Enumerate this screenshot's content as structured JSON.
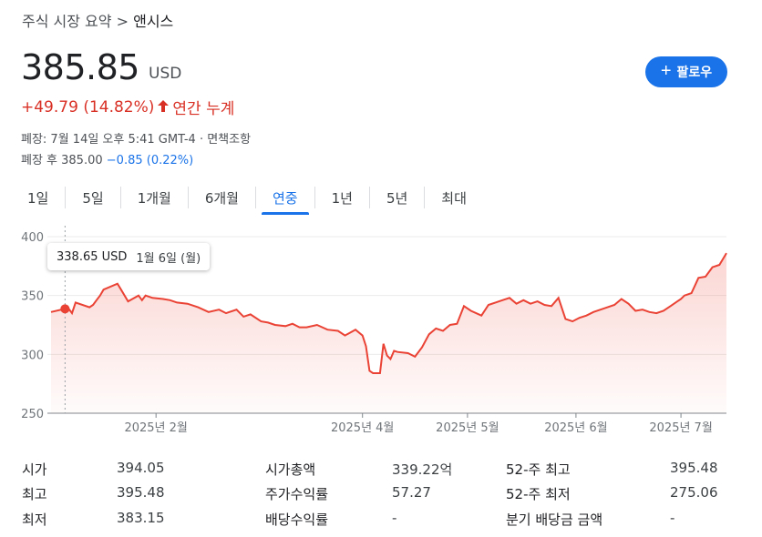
{
  "breadcrumb": {
    "parent": "주식 시장 요약",
    "sep": ">",
    "current": "앤시스"
  },
  "quote": {
    "price": "385.85",
    "currency": "USD",
    "change": "+49.79 (14.82%)",
    "period": "연간 누계",
    "closed_info": "폐장: 7월 14일 오후 5:41 GMT-4 · 면책조항",
    "after_label": "폐장 후 385.00",
    "after_change": "−0.85 (0.22%)"
  },
  "follow_button": {
    "label": "팔로우",
    "icon": "plus-icon"
  },
  "tabs": [
    {
      "label": "1일"
    },
    {
      "label": "5일"
    },
    {
      "label": "1개월"
    },
    {
      "label": "6개월"
    },
    {
      "label": "연중",
      "active": true
    },
    {
      "label": "1년"
    },
    {
      "label": "5년"
    },
    {
      "label": "최대"
    }
  ],
  "tooltip": {
    "value": "338.65 USD",
    "date": "1월 6일 (월)"
  },
  "colors": {
    "accent": "#1a73e8",
    "negative": "#d93025",
    "line": "#ea4335"
  },
  "chart_data": {
    "type": "area",
    "ylim": [
      250,
      400
    ],
    "yticks": [
      "400",
      "350",
      "300",
      "250"
    ],
    "xtick_labels": [
      "2025년 2월",
      "2025년 4월",
      "2025년 5월",
      "2025년 6월",
      "2025년 7월"
    ],
    "xtick_dates": [
      "2025-02-01",
      "2025-04-01",
      "2025-05-01",
      "2025-06-01",
      "2025-07-01"
    ],
    "range": [
      "2025-01-02",
      "2025-07-14"
    ],
    "series": [
      {
        "x": [
          "2025-01-02",
          "2025-01-06",
          "2025-01-07",
          "2025-01-08",
          "2025-01-09",
          "2025-01-13",
          "2025-01-14",
          "2025-01-15",
          "2025-01-16",
          "2025-01-17",
          "2025-01-21",
          "2025-01-22",
          "2025-01-24",
          "2025-01-27",
          "2025-01-28",
          "2025-01-29",
          "2025-01-31",
          "2025-02-03",
          "2025-02-05",
          "2025-02-07",
          "2025-02-10",
          "2025-02-13",
          "2025-02-16",
          "2025-02-19",
          "2025-02-21",
          "2025-02-24",
          "2025-02-26",
          "2025-02-28",
          "2025-03-03",
          "2025-03-05",
          "2025-03-07",
          "2025-03-10",
          "2025-03-12",
          "2025-03-14",
          "2025-03-16",
          "2025-03-19",
          "2025-03-22",
          "2025-03-25",
          "2025-03-27",
          "2025-03-30",
          "2025-04-01",
          "2025-04-02",
          "2025-04-03",
          "2025-04-04",
          "2025-04-06",
          "2025-04-07",
          "2025-04-08",
          "2025-04-09",
          "2025-04-10",
          "2025-04-11",
          "2025-04-14",
          "2025-04-16",
          "2025-04-18",
          "2025-04-20",
          "2025-04-22",
          "2025-04-24",
          "2025-04-26",
          "2025-04-28",
          "2025-04-30",
          "2025-05-02",
          "2025-05-05",
          "2025-05-07",
          "2025-05-09",
          "2025-05-11",
          "2025-05-13",
          "2025-05-15",
          "2025-05-17",
          "2025-05-19",
          "2025-05-21",
          "2025-05-23",
          "2025-05-25",
          "2025-05-27",
          "2025-05-29",
          "2025-05-31",
          "2025-06-02",
          "2025-06-04",
          "2025-06-06",
          "2025-06-08",
          "2025-06-10",
          "2025-06-12",
          "2025-06-14",
          "2025-06-16",
          "2025-06-18",
          "2025-06-20",
          "2025-06-22",
          "2025-06-24",
          "2025-06-26",
          "2025-06-28",
          "2025-06-30",
          "2025-07-01",
          "2025-07-02",
          "2025-07-04",
          "2025-07-06",
          "2025-07-08",
          "2025-07-10",
          "2025-07-12",
          "2025-07-14"
        ],
        "y": [
          336,
          338.65,
          339,
          335,
          344,
          340,
          342,
          346,
          350,
          355,
          360,
          355,
          345,
          350,
          346,
          350,
          348,
          347,
          346,
          344,
          343,
          340,
          336,
          338,
          335,
          338,
          332,
          334,
          328,
          327,
          325,
          324,
          326,
          323,
          323,
          325,
          321,
          320,
          316,
          321,
          316,
          307,
          286,
          284,
          284,
          309,
          299,
          296,
          303,
          302,
          301,
          298,
          306,
          317,
          322,
          320,
          325,
          326,
          341,
          337,
          333,
          342,
          344,
          346,
          348,
          343,
          346,
          343,
          345,
          342,
          341,
          348,
          330,
          328,
          331,
          333,
          336,
          338,
          340,
          342,
          347,
          343,
          337,
          338,
          336,
          335,
          337,
          341,
          345,
          347,
          350,
          352,
          365,
          366,
          374,
          376,
          386
        ]
      }
    ]
  },
  "stats": {
    "col1": [
      {
        "label": "시가",
        "value": "394.05"
      },
      {
        "label": "최고",
        "value": "395.48"
      },
      {
        "label": "최저",
        "value": "383.15"
      }
    ],
    "col2": [
      {
        "label": "시가총액",
        "value": "339.22억"
      },
      {
        "label": "주가수익률",
        "value": "57.27"
      },
      {
        "label": "배당수익률",
        "value": "-"
      }
    ],
    "col3": [
      {
        "label": "52-주 최고",
        "value": "395.48"
      },
      {
        "label": "52-주 최저",
        "value": "275.06"
      },
      {
        "label": "분기 배당금 금액",
        "value": "-"
      }
    ]
  }
}
